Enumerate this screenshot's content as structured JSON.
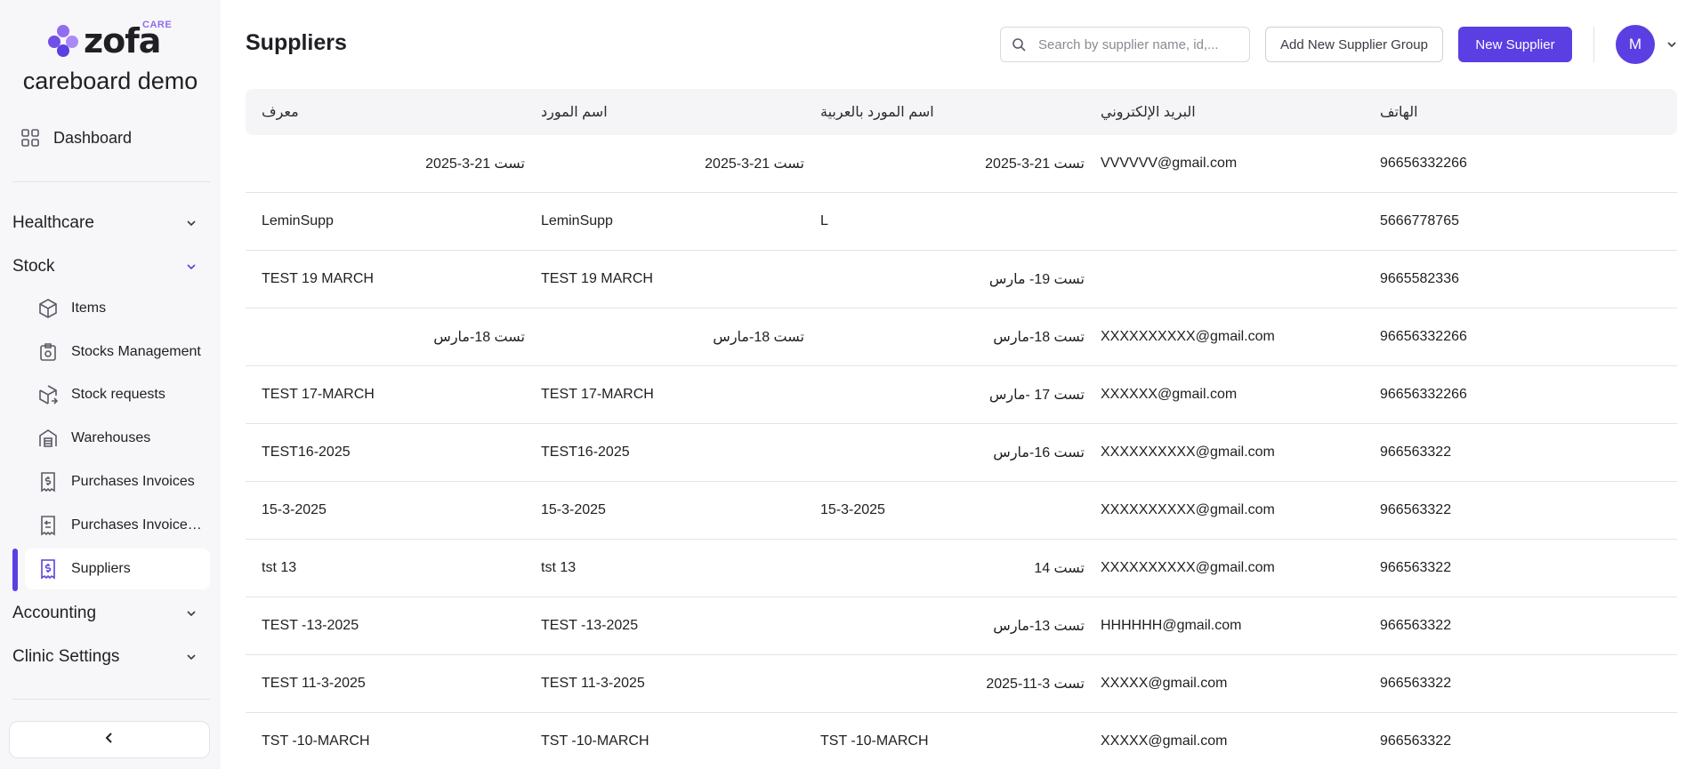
{
  "brand": {
    "logo_text": "zofa",
    "logo_badge": "CARE",
    "org_name": "careboard demo",
    "accent_color": "#5b3fe3",
    "logo_color": "#8f6cf2"
  },
  "sidebar": {
    "dashboard": {
      "label": "Dashboard",
      "icon": "grid-icon"
    },
    "sections": [
      {
        "label": "Healthcare",
        "expanded": false
      },
      {
        "label": "Stock",
        "expanded": true
      },
      {
        "label": "Accounting",
        "expanded": false
      },
      {
        "label": "Clinic Settings",
        "expanded": false
      }
    ],
    "stock_items": [
      {
        "label": "Items",
        "icon": "cube-icon"
      },
      {
        "label": "Stocks Management",
        "icon": "stock-management-icon"
      },
      {
        "label": "Stock requests",
        "icon": "stock-request-icon"
      },
      {
        "label": "Warehouses",
        "icon": "warehouse-icon"
      },
      {
        "label": "Purchases Invoices",
        "icon": "invoice-icon"
      },
      {
        "label": "Purchases Invoices Returns",
        "icon": "invoice-return-icon"
      },
      {
        "label": "Suppliers",
        "icon": "supplier-icon",
        "active": true
      }
    ],
    "collapse_icon": "chevron-left-icon"
  },
  "header": {
    "title": "Suppliers",
    "search_placeholder": "Search by supplier name, id,...",
    "search_value": "",
    "add_group_label": "Add New Supplier Group",
    "new_supplier_label": "New Supplier",
    "avatar_initial": "M"
  },
  "table": {
    "columns": [
      "معرف",
      "اسم المورد",
      "اسم المورد بالعربية",
      "البريد الإلكتروني",
      "الهاتف"
    ],
    "rows": [
      [
        "تست 21-3-2025",
        "تست 21-3-2025",
        "تست 21-3-2025",
        "VVVVVV@gmail.com",
        "96656332266"
      ],
      [
        "LeminSupp",
        "LeminSupp",
        "L",
        "",
        "5666778765"
      ],
      [
        "TEST 19 MARCH",
        "TEST 19 MARCH",
        "تست 19- مارس",
        "",
        "9665582336"
      ],
      [
        "تست 18-مارس",
        "تست 18-مارس",
        "تست 18-مارس",
        "XXXXXXXXXX@gmail.com",
        "96656332266"
      ],
      [
        "TEST 17-MARCH",
        "TEST 17-MARCH",
        "تست 17 -مارس",
        "XXXXXX@gmail.com",
        "96656332266"
      ],
      [
        "TEST16-2025",
        "TEST16-2025",
        "تست 16-مارس",
        "XXXXXXXXXX@gmail.com",
        "966563322"
      ],
      [
        "15-3-2025",
        "15-3-2025",
        "15-3-2025",
        "XXXXXXXXXX@gmail.com",
        "966563322"
      ],
      [
        "tst 13",
        "tst 13",
        "تست 14",
        "XXXXXXXXXX@gmail.com",
        "966563322"
      ],
      [
        "TEST -13-2025",
        "TEST -13-2025",
        "تست 13-مارس",
        "HHHHHH@gmail.com",
        "966563322"
      ],
      [
        "TEST 11-3-2025",
        "TEST 11-3-2025",
        "تست 3-11-2025",
        "XXXXX@gmail.com",
        "966563322"
      ],
      [
        "TST -10-MARCH",
        "TST -10-MARCH",
        "TST -10-MARCH",
        "XXXXX@gmail.com",
        "966563322"
      ]
    ]
  }
}
